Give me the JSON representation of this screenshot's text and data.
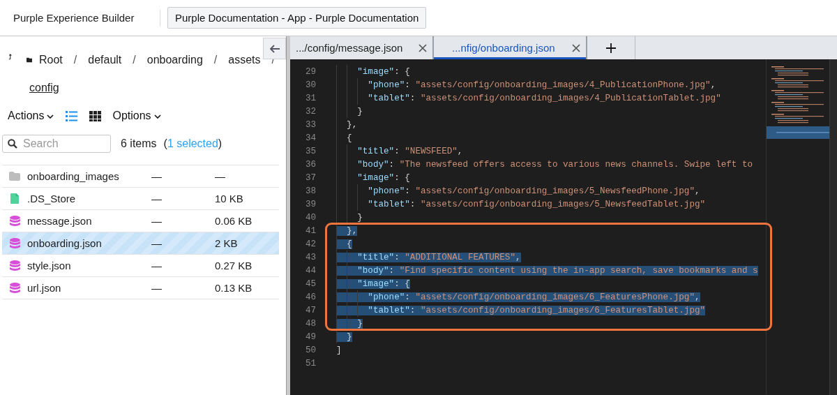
{
  "header": {
    "app_title": "Purple Experience Builder",
    "project_button": "Purple Documentation - App - Purple Documentation"
  },
  "browser": {
    "breadcrumb": [
      "Root",
      "default",
      "onboarding",
      "assets"
    ],
    "breadcrumb_separators": [
      "/",
      "/",
      "/",
      "/"
    ],
    "current_folder": "config",
    "toolbar": {
      "actions": "Actions",
      "options": "Options",
      "view": [
        {
          "kind": "list",
          "selected": true
        },
        {
          "kind": "grid",
          "selected": false
        }
      ]
    },
    "search": {
      "placeholder": "Search"
    },
    "count": "6 items",
    "selection_open": "(",
    "selection": "1 selected",
    "selection_close": ")",
    "rows": [
      {
        "kind": "folder",
        "name": "onboarding_images",
        "modified": "—",
        "size": "—",
        "selected": false
      },
      {
        "kind": "file",
        "name": ".DS_Store",
        "modified": "—",
        "size": "10 KB",
        "selected": false
      },
      {
        "kind": "json",
        "name": "message.json",
        "modified": "—",
        "size": "0.06 KB",
        "selected": false
      },
      {
        "kind": "json",
        "name": "onboarding.json",
        "modified": "—",
        "size": "2 KB",
        "selected": true
      },
      {
        "kind": "json",
        "name": "style.json",
        "modified": "—",
        "size": "0.27 KB",
        "selected": false
      },
      {
        "kind": "json",
        "name": "url.json",
        "modified": "—",
        "size": "0.13 KB",
        "selected": false
      }
    ]
  },
  "editor": {
    "tabs": [
      {
        "label": ".../config/message.json",
        "selected": false
      },
      {
        "label": "...nfig/onboarding.json",
        "selected": true
      }
    ],
    "blocks": [
      {
        "callout": false,
        "lines": [
          {
            "number": "29",
            "text": "    \"image\": {",
            "selected": false
          },
          {
            "number": "30",
            "text": "      \"phone\": \"assets/config/onboarding_images/4_PublicationPhone.jpg\",",
            "selected": false
          },
          {
            "number": "31",
            "text": "      \"tablet\": \"assets/config/onboarding_images/4_PublicationTablet.jpg\"",
            "selected": false
          },
          {
            "number": "32",
            "text": "    }",
            "selected": false
          },
          {
            "number": "33",
            "text": "  },",
            "selected": false
          },
          {
            "number": "34",
            "text": "  {",
            "selected": false
          },
          {
            "number": "35",
            "text": "    \"title\": \"NEWSFEED\",",
            "selected": false
          },
          {
            "number": "36",
            "text": "    \"body\": \"The newsfeed offers access to various news channels. Swipe left to",
            "selected": false
          },
          {
            "number": "37",
            "text": "    \"image\": {",
            "selected": false
          },
          {
            "number": "38",
            "text": "      \"phone\": \"assets/config/onboarding_images/5_NewsfeedPhone.jpg\",",
            "selected": false
          },
          {
            "number": "39",
            "text": "      \"tablet\": \"assets/config/onboarding_images/5_NewsfeedTablet.jpg\"",
            "selected": false
          },
          {
            "number": "40",
            "text": "    }",
            "selected": false
          }
        ]
      },
      {
        "callout": true,
        "lines": [
          {
            "number": "41",
            "text": "  },",
            "selected": true
          },
          {
            "number": "42",
            "text": "  {",
            "selected": true
          },
          {
            "number": "43",
            "text": "    \"title\": \"ADDITIONAL FEATURES\",",
            "selected": true
          },
          {
            "number": "44",
            "text": "    \"body\": \"Find specific content using the in-app search, save bookmarks and s",
            "selected": true
          },
          {
            "number": "45",
            "text": "    \"image\": {",
            "selected": true
          },
          {
            "number": "46",
            "text": "      \"phone\": \"assets/config/onboarding_images/6_FeaturesPhone.jpg\",",
            "selected": true
          },
          {
            "number": "47",
            "text": "      \"tablet\": \"assets/config/onboarding_images/6_FeaturesTablet.jpg\"",
            "selected": true
          },
          {
            "number": "48",
            "text": "    }",
            "selected": true
          }
        ]
      },
      {
        "callout": false,
        "lines": [
          {
            "number": "49",
            "text": "  }",
            "selected": true
          },
          {
            "number": "50",
            "text": "]",
            "selected": false
          },
          {
            "number": "51",
            "selected": false
          }
        ]
      }
    ]
  }
}
